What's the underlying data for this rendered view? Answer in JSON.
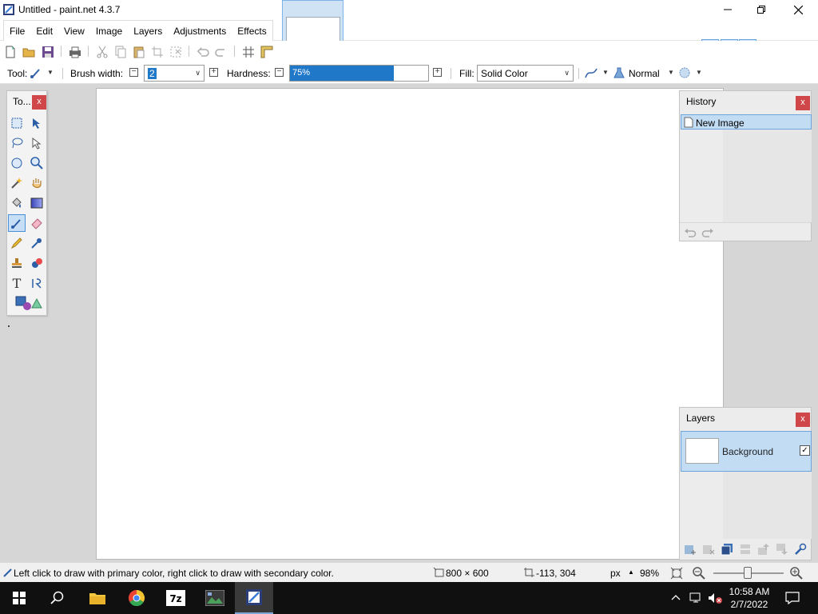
{
  "window": {
    "title": "Untitled - paint.net 4.3.7",
    "minimize": "—",
    "restore": "❐",
    "close": "✕"
  },
  "menu": {
    "items": [
      "File",
      "Edit",
      "View",
      "Image",
      "Layers",
      "Adjustments",
      "Effects"
    ]
  },
  "toolbar2": {
    "tool_label": "Tool:",
    "brush_width_label": "Brush width:",
    "brush_width_value": "2",
    "hardness_label": "Hardness:",
    "hardness_value": "75%",
    "hardness_fraction": 0.75,
    "fill_label": "Fill:",
    "fill_value": "Solid Color",
    "blend_mode": "Normal"
  },
  "tools_panel": {
    "title": "To...",
    "close": "x"
  },
  "history_panel": {
    "title": "History",
    "close": "x",
    "entries": [
      "New Image"
    ]
  },
  "layers_panel": {
    "title": "Layers",
    "close": "x",
    "layers": [
      {
        "name": "Background",
        "visible": true
      }
    ]
  },
  "status": {
    "hint": "Left click to draw with primary color, right click to draw with secondary color.",
    "image_size": "800 × 600",
    "cursor_pos": "-113, 304",
    "unit": "px",
    "zoom": "98%"
  },
  "taskbar": {
    "time": "10:58 AM",
    "date": "2/7/2022",
    "apps": [
      "start",
      "search",
      "file-explorer",
      "chrome",
      "7zip",
      "image-app",
      "paint-net"
    ]
  },
  "colors": {
    "accent": "#1f78c8",
    "selection": "#c2dcf4",
    "close_red": "#d0474a"
  }
}
